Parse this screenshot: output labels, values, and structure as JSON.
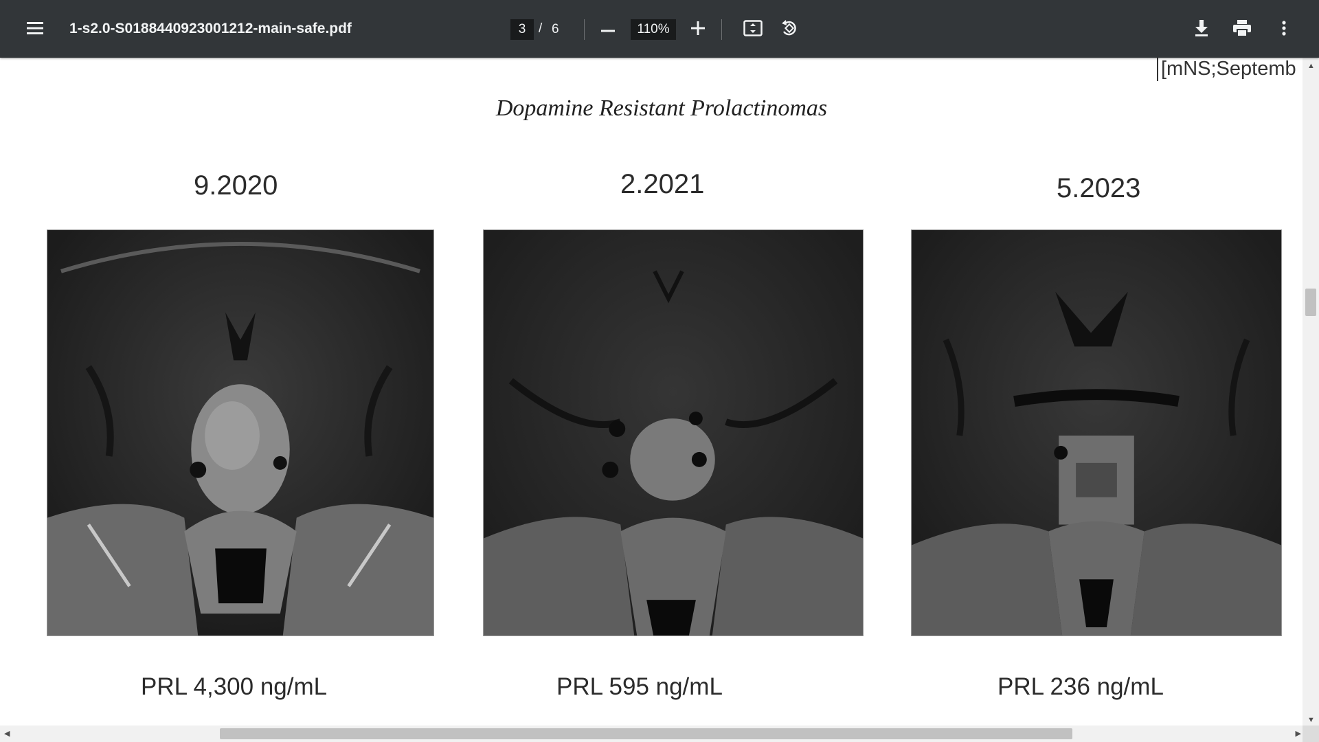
{
  "toolbar": {
    "file_name": "1-s2.0-S0188440923001212-main-safe.pdf",
    "current_page": "3",
    "page_separator": "/",
    "total_pages": "6",
    "zoom": "110%",
    "icons": [
      "menu-icon",
      "zoom-out-icon",
      "zoom-in-icon",
      "fit-page-icon",
      "rotate-icon",
      "download-icon",
      "print-icon",
      "more-vert-icon"
    ]
  },
  "page": {
    "running_head": "[mNS;Septemb",
    "journal_title": "Dopamine Resistant Prolactinomas",
    "panels": [
      {
        "date": "9.2020",
        "prl": "PRL 4,300 ng/mL"
      },
      {
        "date": "2.2021",
        "prl": "PRL 595 ng/mL"
      },
      {
        "date": "5.2023",
        "prl": "PRL 236 ng/mL"
      }
    ]
  },
  "colors": {
    "toolbar_bg": "#323639",
    "toolbar_text": "#f1f3f4",
    "input_bg": "#191b1c",
    "page_bg": "#ffffff",
    "scrollbar_thumb": "#c1c1c1"
  }
}
